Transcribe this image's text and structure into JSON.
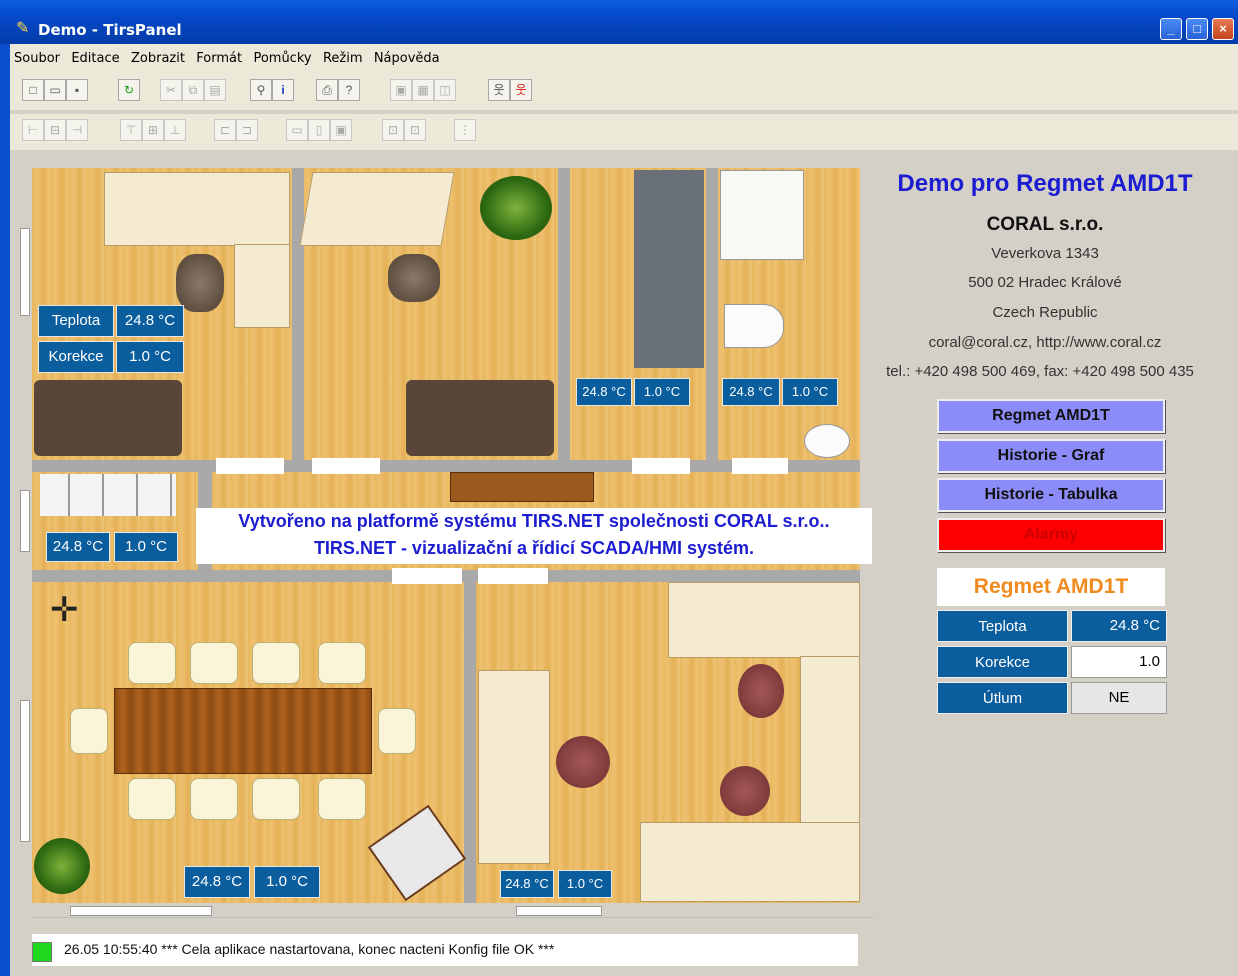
{
  "window": {
    "title": "Demo - TirsPanel"
  },
  "menu": [
    "Soubor",
    "Editace",
    "Zobrazit",
    "Formát",
    "Pomůcky",
    "Režim",
    "Nápověda"
  ],
  "overlay": {
    "line1": "Vytvořeno na platformě systému TIRS.NET společnosti CORAL s.r.o..",
    "line2": "TIRS.NET - vizualizační a řídicí SCADA/HMI systém."
  },
  "rooms": {
    "office1": {
      "label_temp": "Teplota",
      "temp": "24.8 °C",
      "label_corr": "Korekce",
      "corr": "1.0 °C"
    },
    "kitchen": {
      "temp": "24.8 °C",
      "corr": "1.0 °C"
    },
    "bath": {
      "temp": "24.8 °C",
      "corr": "1.0 °C"
    },
    "hall": {
      "temp": "24.8 °C",
      "corr": "1.0 °C"
    },
    "meeting": {
      "temp": "24.8 °C",
      "corr": "1.0 °C"
    },
    "office3": {
      "temp": "24.8 °C",
      "corr": "1.0 °C"
    }
  },
  "info": {
    "title": "Demo pro Regmet AMD1T",
    "company": "CORAL s.r.o.",
    "street": "Veverkova 1343",
    "city": "500 02  Hradec Králové",
    "country": "Czech Republic",
    "web": "coral@coral.cz, http://www.coral.cz",
    "phone": "tel.: +420 498 500 469, fax: +420 498 500 435"
  },
  "buttons": {
    "regmet": "Regmet AMD1T",
    "graph": "Historie - Graf",
    "table": "Historie - Tabulka",
    "alarms": "Alarmy"
  },
  "panel": {
    "title": "Regmet AMD1T",
    "rows": [
      {
        "label": "Teplota",
        "value": "24.8 °C"
      },
      {
        "label": "Korekce",
        "value": "1.0"
      },
      {
        "label": "Útlum",
        "value": "NE"
      }
    ]
  },
  "status": {
    "message": "26.05 10:55:40  *** Cela aplikace nastartovana, konec nacteni Konfig file OK ***"
  },
  "colors": {
    "accent": "#0b5e9e",
    "button": "#8c8cf8",
    "alarm": "#ff0000",
    "title_blue": "#1c1cd0"
  }
}
